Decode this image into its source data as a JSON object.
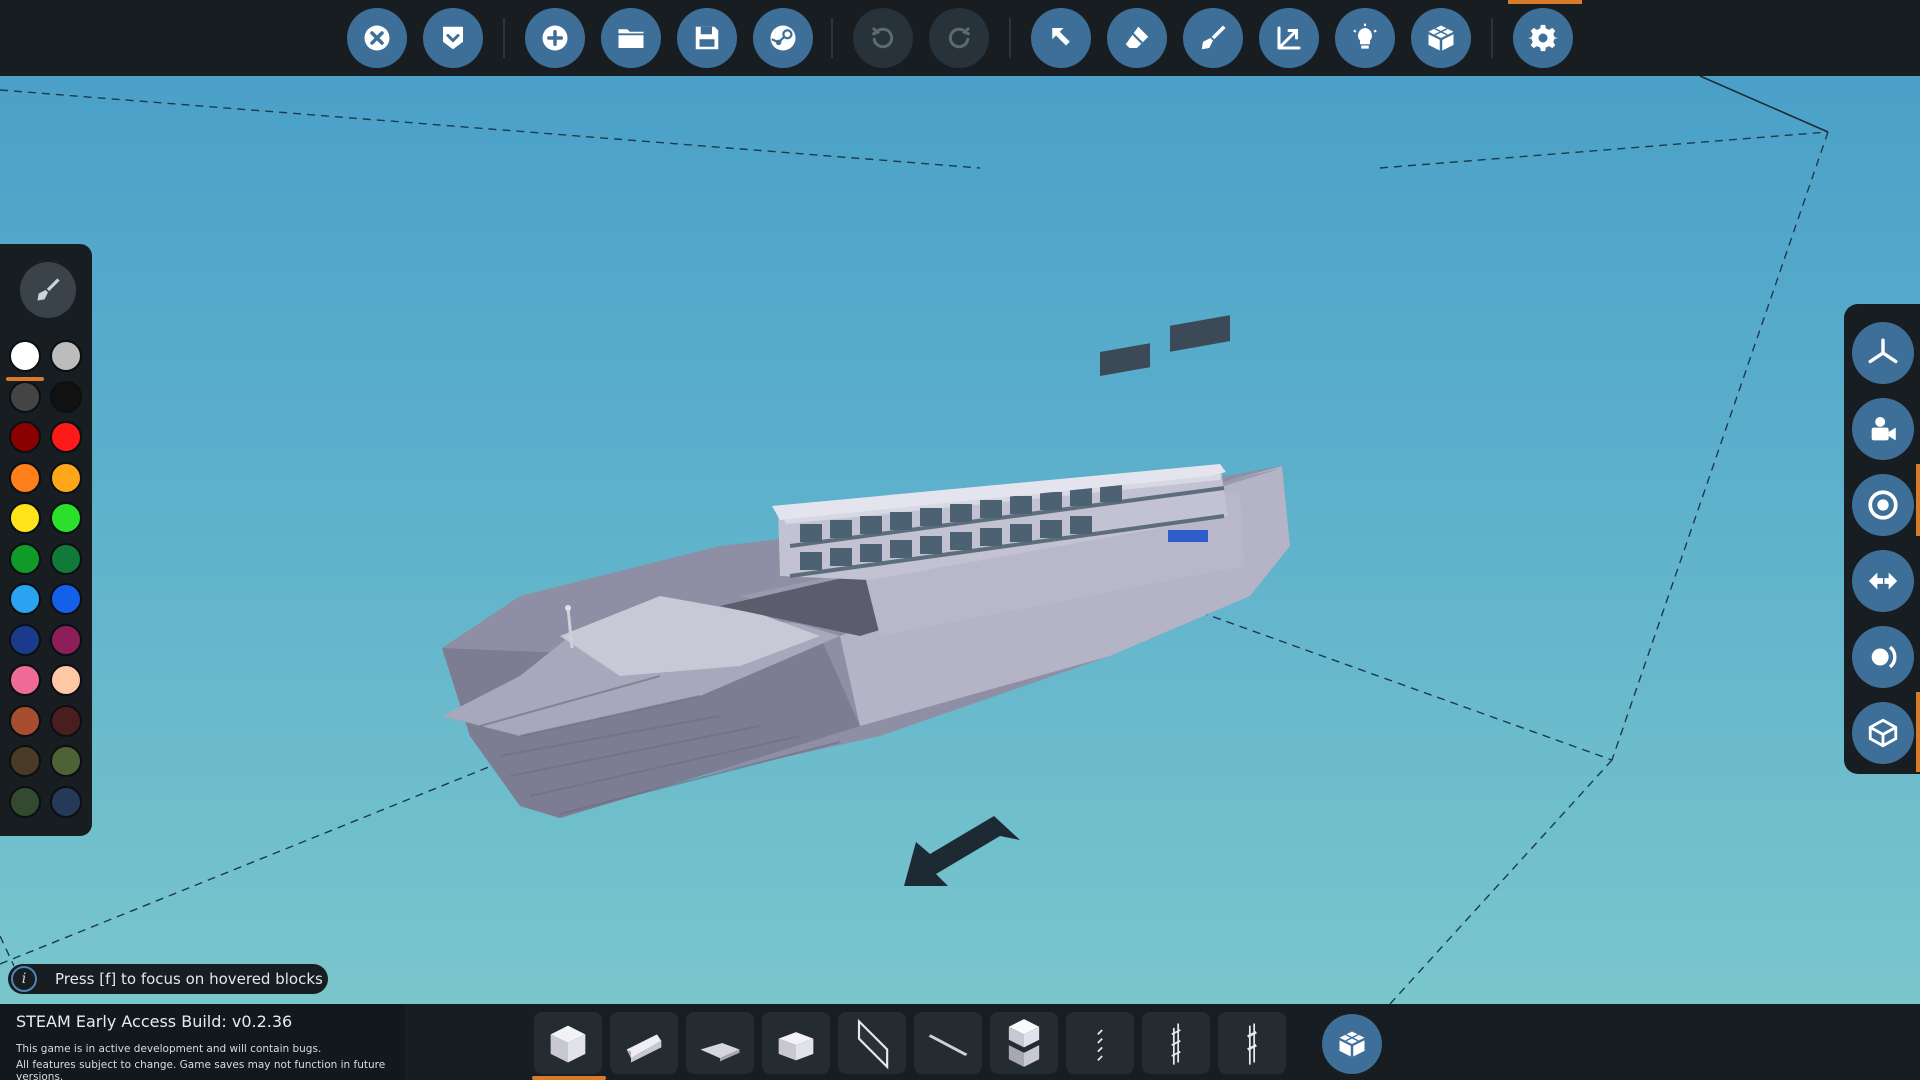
{
  "app": {
    "hint_text": "Press [f] to focus on hovered blocks",
    "build_title": "STEAM Early Access Build: v0.2.36",
    "build_notice_1": "This game is in active development and will contain bugs.",
    "build_notice_2": "All features subject to change. Game saves may not function in future versions."
  },
  "toolbar": {
    "buttons": [
      {
        "icon": "close-icon"
      },
      {
        "icon": "check-shield-icon"
      },
      {
        "icon": "add-icon"
      },
      {
        "icon": "folder-icon"
      },
      {
        "icon": "save-icon"
      },
      {
        "icon": "steam-icon"
      },
      {
        "icon": "undo-icon"
      },
      {
        "icon": "redo-icon"
      },
      {
        "icon": "select-cursor-icon"
      },
      {
        "icon": "eraser-icon"
      },
      {
        "icon": "paint-brush-icon"
      },
      {
        "icon": "resize-arrow-icon"
      },
      {
        "icon": "lightbulb-icon"
      },
      {
        "icon": "blocks-icon"
      },
      {
        "icon": "settings-gear-icon"
      }
    ],
    "active": "settings-gear-icon"
  },
  "palette": {
    "colors": [
      "#ffffff",
      "#bcbcbc",
      "#444444",
      "#111111",
      "#8b0000",
      "#ff1a1a",
      "#ff7f1a",
      "#ffa51a",
      "#ffe31a",
      "#2ae02a",
      "#0f9a2a",
      "#107a3a",
      "#2aa4f0",
      "#1460e8",
      "#1c3a8c",
      "#8c1e5a",
      "#f06a98",
      "#ffc8a4",
      "#a84e30",
      "#4a1e1e",
      "#4a3a28",
      "#4e6238",
      "#324a30",
      "#243a58"
    ],
    "selected_color": "#ffffff"
  },
  "right_panel": {
    "buttons": [
      {
        "icon": "axis-icon"
      },
      {
        "icon": "camera-icon"
      },
      {
        "icon": "focus-target-icon"
      },
      {
        "icon": "mirror-arrows-icon"
      },
      {
        "icon": "rotate-view-icon"
      },
      {
        "icon": "box-view-icon"
      }
    ]
  },
  "bottom_bar": {
    "blocks": [
      {
        "icon": "cube-block-icon"
      },
      {
        "icon": "wedge-block-icon"
      },
      {
        "icon": "corner-block-icon"
      },
      {
        "icon": "half-block-icon"
      },
      {
        "icon": "panel-block-icon"
      },
      {
        "icon": "rod-block-icon"
      },
      {
        "icon": "stacked-block-icon"
      },
      {
        "icon": "thin-rail-icon"
      },
      {
        "icon": "ladder-icon"
      },
      {
        "icon": "railing-icon"
      }
    ],
    "selected_block": "cube-block-icon",
    "inventory_icon": "blocks-icon"
  },
  "colors": {
    "accent": "#d97a2b",
    "button_blue": "#3e6f98",
    "toolbar_bg": "#171d21"
  }
}
